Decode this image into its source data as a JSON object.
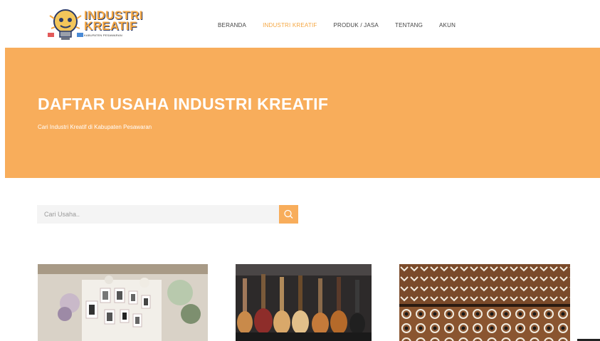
{
  "brand": {
    "name_line1": "INDUSTRI",
    "name_line2": "KREATIF",
    "subtitle": "KABUPATEN PESAWARAN",
    "icon": "lightbulb-mascot-icon"
  },
  "nav": {
    "items": [
      {
        "label": "BERANDA",
        "active": false
      },
      {
        "label": "INDUSTRI KREATIF",
        "active": true
      },
      {
        "label": "PRODUK / JASA",
        "active": false
      },
      {
        "label": "TENTANG",
        "active": false
      },
      {
        "label": "AKUN",
        "active": false
      }
    ]
  },
  "hero": {
    "title": "DAFTAR USAHA INDUSTRI KREATIF",
    "subtitle": "Cari Industri Kreatif di Kabupaten Pesawaran"
  },
  "search": {
    "placeholder": "Cari Usaha..",
    "icon": "search-icon"
  },
  "colors": {
    "accent": "#f8ad5b",
    "nav_active": "#f5a742",
    "text": "#444444"
  },
  "cards": [
    {
      "image": "photo-gallery-wall-decoration"
    },
    {
      "image": "guitar-shop-display"
    },
    {
      "image": "tapis-fabric-pattern"
    }
  ]
}
